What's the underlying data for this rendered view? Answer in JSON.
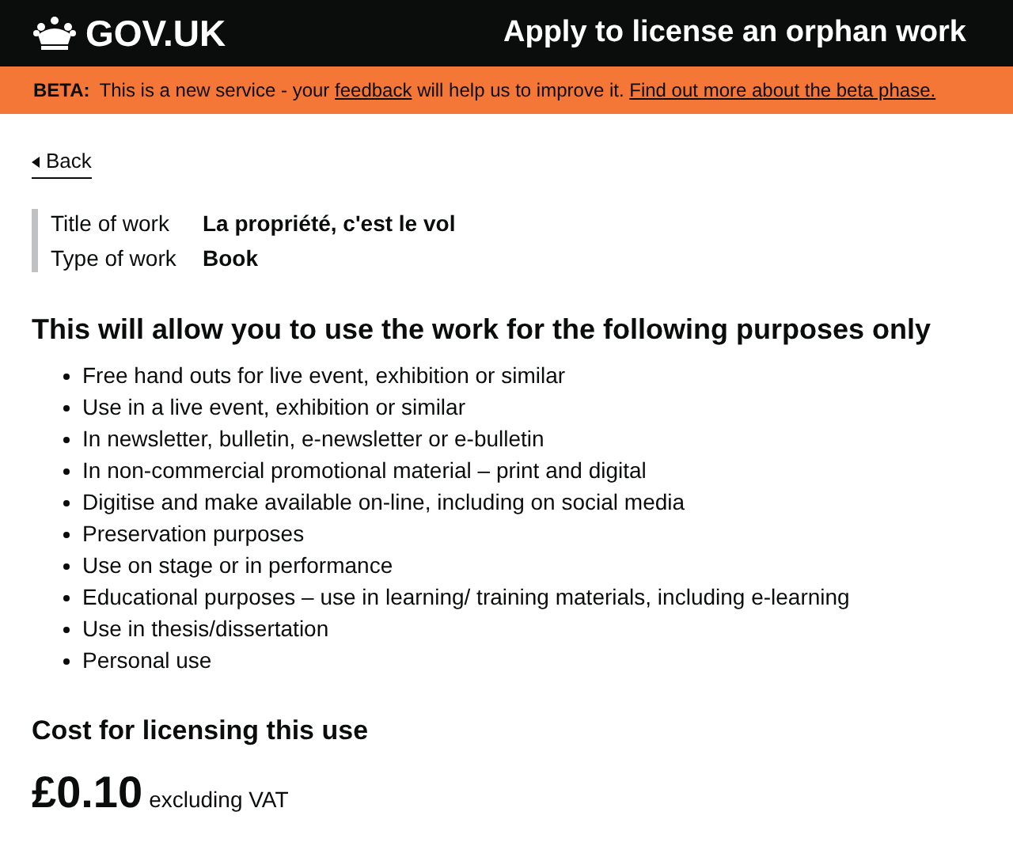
{
  "header": {
    "logo": "GOV.UK",
    "service": "Apply to license an orphan work"
  },
  "beta": {
    "tag": "BETA:",
    "parts": [
      {
        "kind": "text",
        "text": "This is a new service - your"
      },
      {
        "kind": "link",
        "text": "feedback"
      },
      {
        "kind": "text",
        "text": "will help us to improve it."
      },
      {
        "kind": "link",
        "text": "Find out more about the beta phase."
      }
    ]
  },
  "back_link": "Back",
  "summary": [
    {
      "label": "Title of work",
      "value": "La propriété, c'est le vol"
    },
    {
      "label": "Type of work",
      "value": "Book"
    }
  ],
  "purposes_heading": "This will allow you to use the work for the following purposes only",
  "purposes": [
    "Free hand outs for live event, exhibition or similar",
    "Use in a live event, exhibition or similar",
    "In newsletter, bulletin, e-newsletter or e-bulletin",
    "In non-commercial promotional material – print and digital",
    "Digitise and make available on-line, including on social media",
    "Preservation purposes",
    "Use on stage or in performance",
    "Educational purposes – use in learning/ training materials, including e-learning",
    "Use in thesis/dissertation",
    "Personal use"
  ],
  "cost_heading": "Cost for licensing this use",
  "price": "£0.10",
  "price_note": "excluding VAT"
}
